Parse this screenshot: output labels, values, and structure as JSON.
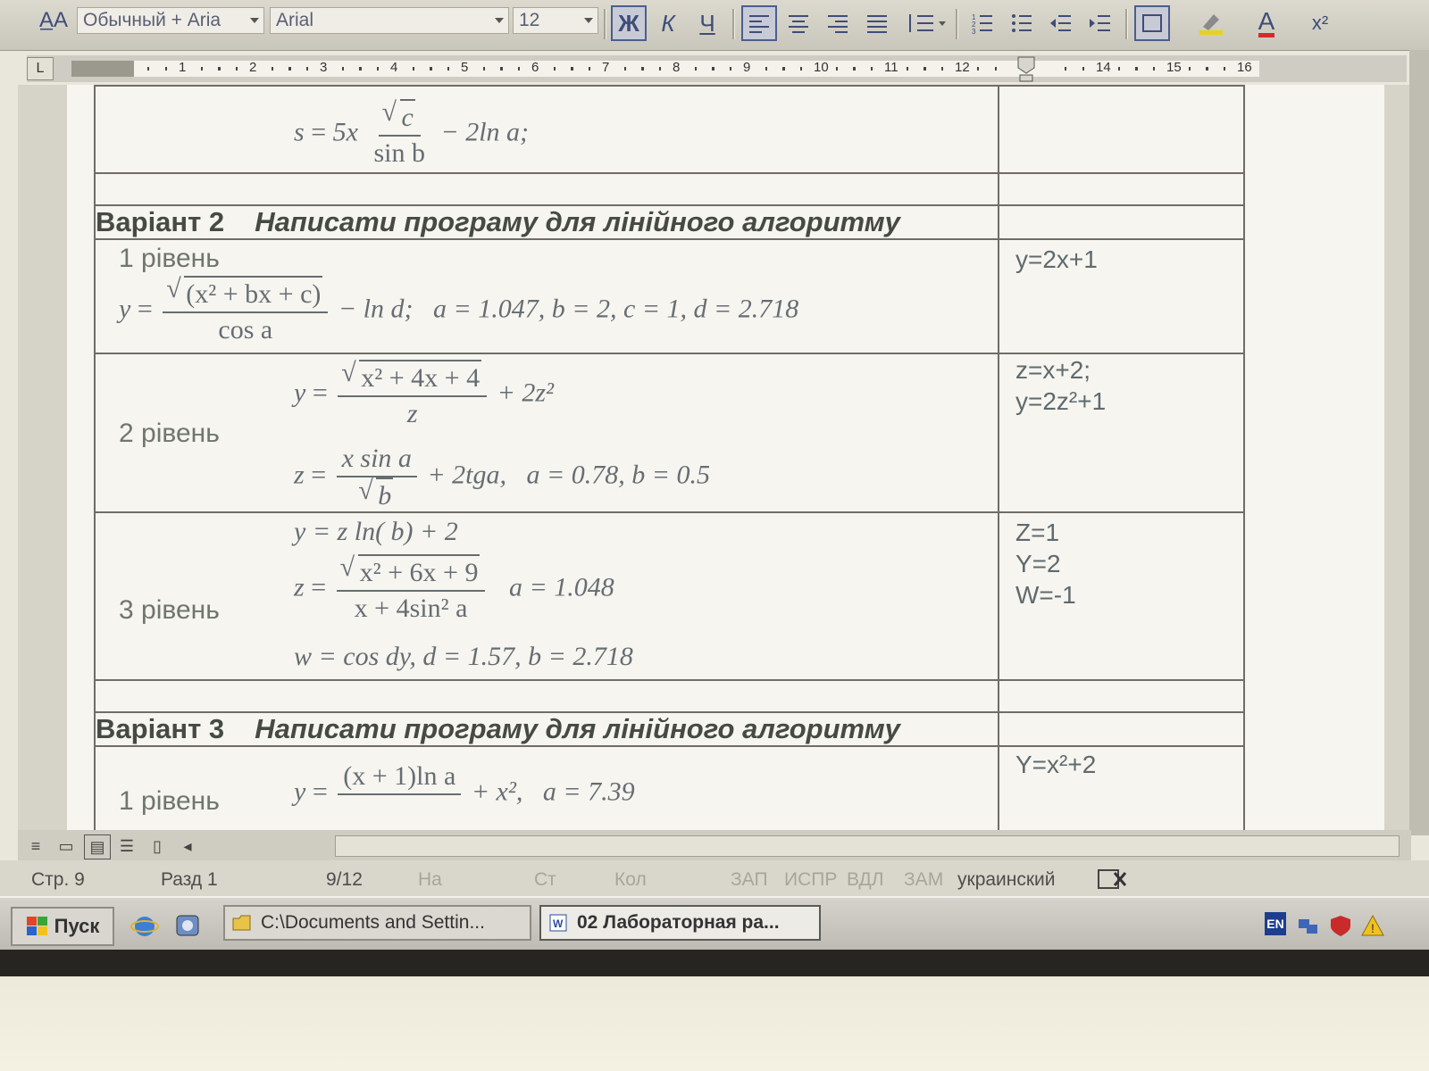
{
  "toolbar": {
    "style": "Обычный + Aria",
    "font": "Arial",
    "size": "12",
    "bold": "Ж",
    "italic": "К",
    "underline": "Ч",
    "font_color_letter": "A",
    "superscript": "x²"
  },
  "ruler": {
    "corner": "L",
    "numbers": [
      "1",
      "2",
      "3",
      "4",
      "5",
      "6",
      "7",
      "8",
      "9",
      "10",
      "11",
      "12",
      "14",
      "15",
      "16"
    ]
  },
  "table": {
    "top_formula": {
      "lhs": "s",
      "coef": "5x",
      "num": "c",
      "den": "sin b",
      "tail": "− 2ln a;"
    },
    "variant2": {
      "label": "Варіант 2",
      "title": "Написати програму для лінійного алгоритму",
      "level1": {
        "label": "1 рівень",
        "formula": {
          "lhs": "y",
          "num": "(x² + bx + c)",
          "den": "cos a",
          "tail": "− ln d;",
          "params": "a = 1.047,   b = 2,   c = 1,   d = 2.718"
        },
        "answer": "y=2x+1"
      },
      "level2": {
        "label": "2 рівень",
        "formula_y": {
          "lhs": "y",
          "num": "x² + 4x + 4",
          "den": "z",
          "tail": "+ 2z²"
        },
        "formula_z": {
          "lhs": "z",
          "num": "x sin a",
          "den": "b",
          "tail": "+ 2tga,",
          "params": "a = 0.78,   b = 0.5"
        },
        "answer": "z=x+2;\ny=2z²+1"
      },
      "level3": {
        "label": "3 рівень",
        "formula_y": "y = z ln( b) + 2",
        "formula_z": {
          "lhs": "z",
          "num": "x² + 6x + 9",
          "den": "x + 4sin² a",
          "params": "a = 1.048"
        },
        "formula_w": "w = cos dy,   d = 1.57,   b = 2.718",
        "answer": "Z=1\nY=2\nW=-1"
      }
    },
    "variant3": {
      "label": "Варіант 3",
      "title": "Написати програму для лінійного алгоритму",
      "level1": {
        "label": "1 рівень",
        "formula": {
          "lhs": "y",
          "num": "(x + 1)ln a",
          "tail": "+ x²,",
          "params": "a = 7.39"
        },
        "answer": "Y=x²+2"
      }
    }
  },
  "status": {
    "page": "Стр.  9",
    "section": "Разд  1",
    "pages": "9/12",
    "at": "На",
    "line": "Ст",
    "col": "Кол",
    "rec": "ЗАП",
    "trk": "ИСПР",
    "ext": "ВДЛ",
    "ovr": "ЗАМ",
    "lang": "украинский"
  },
  "taskbar": {
    "start": "Пуск",
    "task1": "C:\\Documents and Settin...",
    "task2": "02 Лабораторная ра...",
    "lang": "EN"
  }
}
